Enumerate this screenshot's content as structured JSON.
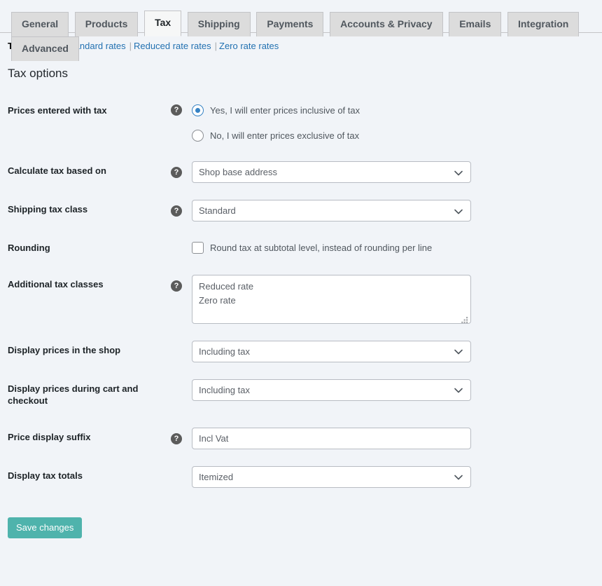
{
  "tabs": [
    {
      "label": "General",
      "active": false
    },
    {
      "label": "Products",
      "active": false
    },
    {
      "label": "Tax",
      "active": true
    },
    {
      "label": "Shipping",
      "active": false
    },
    {
      "label": "Payments",
      "active": false
    },
    {
      "label": "Accounts & Privacy",
      "active": false
    },
    {
      "label": "Emails",
      "active": false
    },
    {
      "label": "Integration",
      "active": false
    },
    {
      "label": "Advanced",
      "active": false
    }
  ],
  "subnav": {
    "items": [
      {
        "label": "Tax options",
        "current": true
      },
      {
        "label": "Standard rates",
        "current": false
      },
      {
        "label": "Reduced rate rates",
        "current": false
      },
      {
        "label": "Zero rate rates",
        "current": false
      }
    ],
    "separator": "|"
  },
  "section": {
    "title": "Tax options"
  },
  "help_icon_glyph": "?",
  "rows": {
    "prices_entered_with_tax": {
      "label": "Prices entered with tax",
      "help": "?",
      "options": [
        {
          "label": "Yes, I will enter prices inclusive of tax",
          "checked": true
        },
        {
          "label": "No, I will enter prices exclusive of tax",
          "checked": false
        }
      ]
    },
    "calculate_tax_based_on": {
      "label": "Calculate tax based on",
      "help": "?",
      "value": "Shop base address"
    },
    "shipping_tax_class": {
      "label": "Shipping tax class",
      "help": "?",
      "value": "Standard"
    },
    "rounding": {
      "label": "Rounding",
      "option_label": "Round tax at subtotal level, instead of rounding per line",
      "checked": false
    },
    "additional_tax_classes": {
      "label": "Additional tax classes",
      "help": "?",
      "value": "Reduced rate\nZero rate"
    },
    "display_prices_in_shop": {
      "label": "Display prices in the shop",
      "value": "Including tax"
    },
    "display_prices_cart_checkout": {
      "label": "Display prices during cart and checkout",
      "value": "Including tax"
    },
    "price_display_suffix": {
      "label": "Price display suffix",
      "help": "?",
      "value": "Incl Vat"
    },
    "display_tax_totals": {
      "label": "Display tax totals",
      "value": "Itemized"
    }
  },
  "submit": {
    "label": "Save changes"
  },
  "colors": {
    "page_background": "#f1f4f8",
    "accent_link": "#2271b1",
    "radio_selected": "#3582c4",
    "primary_button": "#4fb3ac",
    "tab_inactive": "#dcdcdc",
    "tab_active": "#f6f7f7"
  }
}
